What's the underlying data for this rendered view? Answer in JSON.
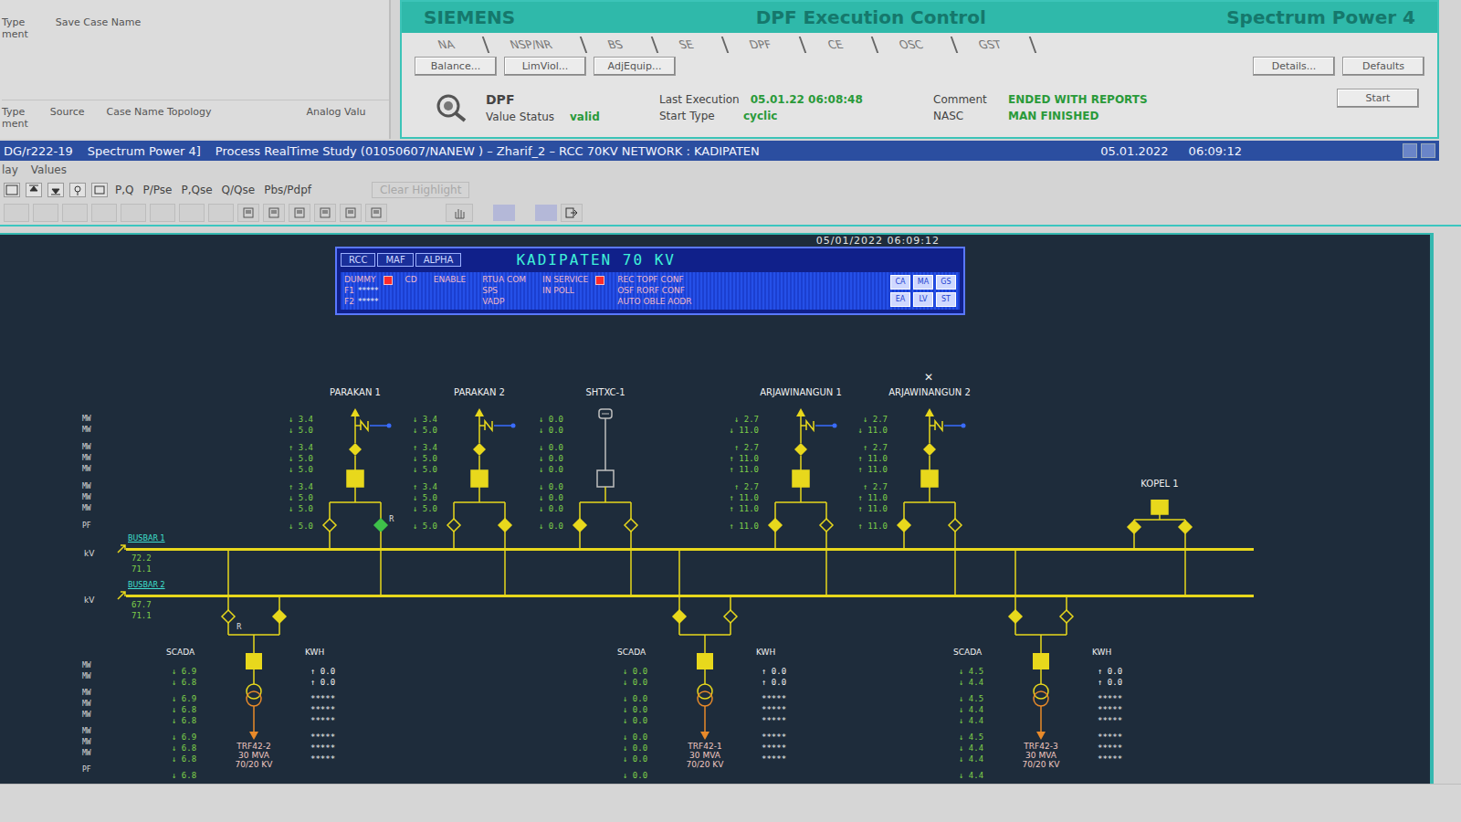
{
  "case_panel": {
    "top": [
      {
        "text": "Type",
        "sub": "ment"
      },
      {
        "text": "Save Case Name",
        "sub": ""
      }
    ],
    "bottom": [
      {
        "text": "Type",
        "sub": "ment"
      },
      {
        "text": "Source",
        "sub": ""
      },
      {
        "text": "Case Name Topology",
        "sub": ""
      },
      {
        "text": "Analog Valu",
        "sub": ""
      }
    ]
  },
  "dpf_panel": {
    "brand": "SIEMENS",
    "title": "DPF Execution Control",
    "product": "Spectrum Power 4",
    "tabs": [
      {
        "label": "NA",
        "selected": false
      },
      {
        "label": "NSP/NR",
        "selected": false
      },
      {
        "label": "BS",
        "selected": false
      },
      {
        "label": "SE",
        "selected": false
      },
      {
        "label": "DPF",
        "selected": false
      },
      {
        "label": "CE",
        "selected": false
      },
      {
        "label": "OSC",
        "selected": false
      },
      {
        "label": "GST",
        "selected": false
      }
    ],
    "buttons_left": [
      "Balance...",
      "LimViol...",
      "AdjEquip..."
    ],
    "buttons_right": [
      "Details...",
      "Defaults"
    ],
    "field_columns": [
      [
        {
          "label": "DPF",
          "value": ""
        },
        {
          "label": "Value Status",
          "value": "valid"
        }
      ],
      [
        {
          "label": "Last Execution",
          "value": "05.01.22 06:08:48"
        },
        {
          "label": "Start Type",
          "value": "cyclic"
        }
      ],
      [
        {
          "label": "Comment",
          "value": "ENDED WITH REPORTS"
        },
        {
          "label": "NASC",
          "value": "MAN FINISHED"
        }
      ]
    ],
    "start_button": "Start"
  },
  "title_bar": {
    "parts": [
      "DG/r222-19",
      "Spectrum Power 4]",
      "Process RealTime Study (01050607/NANEW ) – Zharif_2 – RCC 70KV NETWORK : KADIPATEN"
    ],
    "date": "05.01.2022",
    "time": "06:09:12"
  },
  "menu": [
    "lay",
    "Values"
  ],
  "toolbar": {
    "modes": [
      "P,Q",
      "P/Pse",
      "P,Qse",
      "Q/Qse",
      "Pbs/Pdpf"
    ],
    "clear": {
      "label": "Clear Highlight",
      "disabled": true
    }
  },
  "diagram": {
    "nav": [
      "RCC",
      "MAF",
      "ALPHA"
    ],
    "title": "KADIPATEN 70 KV",
    "timestamp": "05/01/2022 06:09:12",
    "status_groups": [
      {
        "items": [
          {
            "text": "DUMMY",
            "value": "",
            "alarm": true
          },
          {
            "text": "F1",
            "value": "*****",
            "alarm": false
          },
          {
            "text": "F2",
            "value": "*****",
            "alarm": false
          }
        ]
      },
      {
        "items": [
          {
            "text": "CD",
            "value": "",
            "alarm": false
          }
        ]
      },
      {
        "items": [
          {
            "text": "ENABLE",
            "value": "",
            "alarm": false
          }
        ]
      },
      {
        "items": [
          {
            "text": "RTUA COM",
            "value": "",
            "alarm": false
          },
          {
            "text": "SPS",
            "value": "",
            "alarm": false
          },
          {
            "text": "VADP",
            "value": "",
            "alarm": false
          }
        ]
      },
      {
        "items": [
          {
            "text": "IN SERVICE",
            "value": "",
            "alarm": true
          },
          {
            "text": "IN POLL",
            "value": "",
            "alarm": false
          }
        ]
      },
      {
        "items": [
          {
            "text": "REC TOPF CONF",
            "value": "",
            "alarm": false
          },
          {
            "text": "OSF RORF CONF",
            "value": "",
            "alarm": false
          },
          {
            "text": "AUTO OBLE AODR",
            "value": "",
            "alarm": false
          }
        ]
      }
    ],
    "flags": [
      "CA",
      "MA",
      "GS",
      "EA",
      "LV",
      "ST"
    ],
    "axis_top": [
      [
        "MW",
        "MW"
      ],
      [
        "MW",
        "MW",
        "MW"
      ],
      [
        "MW",
        "MW",
        "MW"
      ],
      [
        "PF"
      ]
    ],
    "axis_bus": [
      "kV",
      "kV"
    ],
    "axis_bottom": [
      [
        "MW",
        "MW"
      ],
      [
        "MW",
        "MW",
        "MW"
      ],
      [
        "MW",
        "MW",
        "MW"
      ],
      [
        "PF"
      ]
    ],
    "busbars": [
      {
        "name": "BUSBAR 1",
        "values": [
          "72.2",
          "71.1"
        ]
      },
      {
        "name": "BUSBAR 2",
        "values": [
          "67.7",
          "71.1"
        ]
      }
    ],
    "bays": [
      {
        "name": "PARAKAN 1",
        "kind": "feeder",
        "energized": true,
        "breaker_closed": true,
        "mark": "",
        "values": [
          [
            "↓ 3.4",
            "↓ 5.0"
          ],
          [
            "↑ 3.4",
            "↓ 5.0",
            "↓ 5.0"
          ],
          [
            "↑ 3.4",
            "↓ 5.0",
            "↓ 5.0"
          ],
          [
            "↓ 5.0"
          ]
        ],
        "switches": [
          {
            "closed": false,
            "tag": "",
            "color": "#e8d81c"
          },
          {
            "closed": true,
            "tag": "R",
            "color": "#3ec04a"
          }
        ]
      },
      {
        "name": "PARAKAN 2",
        "kind": "feeder",
        "energized": true,
        "breaker_closed": true,
        "mark": "",
        "values": [
          [
            "↓ 3.4",
            "↓ 5.0"
          ],
          [
            "↑ 3.4",
            "↓ 5.0",
            "↓ 5.0"
          ],
          [
            "↑ 3.4",
            "↓ 5.0",
            "↓ 5.0"
          ],
          [
            "↓ 5.0"
          ]
        ],
        "switches": [
          {
            "closed": false,
            "tag": "",
            "color": "#e8d81c"
          },
          {
            "closed": true,
            "tag": "",
            "color": "#e8d81c"
          }
        ]
      },
      {
        "name": "SHTXC-1",
        "kind": "capacitor",
        "energized": false,
        "breaker_closed": false,
        "mark": "",
        "values": [
          [
            "↓ 0.0",
            "↓ 0.0"
          ],
          [
            "↓ 0.0",
            "↓ 0.0",
            "↓ 0.0"
          ],
          [
            "↓ 0.0",
            "↓ 0.0",
            "↓ 0.0"
          ],
          [
            "↓ 0.0"
          ]
        ],
        "switches": [
          {
            "closed": true,
            "tag": "",
            "color": "#e8d81c"
          },
          {
            "closed": false,
            "tag": "",
            "color": "#e8d81c"
          }
        ]
      },
      {
        "name": "ARJAWINANGUN 1",
        "kind": "feeder",
        "energized": true,
        "breaker_closed": true,
        "mark": "",
        "values": [
          [
            "↓ 2.7",
            "↓ 11.0"
          ],
          [
            "↑ 2.7",
            "↑ 11.0",
            "↑ 11.0"
          ],
          [
            "↑ 2.7",
            "↑ 11.0",
            "↑ 11.0"
          ],
          [
            "↑ 11.0"
          ]
        ],
        "switches": [
          {
            "closed": true,
            "tag": "",
            "color": "#e8d81c"
          },
          {
            "closed": false,
            "tag": "",
            "color": "#e8d81c"
          }
        ]
      },
      {
        "name": "ARJAWINANGUN 2",
        "kind": "feeder",
        "energized": true,
        "breaker_closed": true,
        "mark": "✕",
        "values": [
          [
            "↓ 2.7",
            "↓ 11.0"
          ],
          [
            "↑ 2.7",
            "↑ 11.0",
            "↑ 11.0"
          ],
          [
            "↑ 2.7",
            "↑ 11.0",
            "↑ 11.0"
          ],
          [
            "↑ 11.0"
          ]
        ],
        "switches": [
          {
            "closed": true,
            "tag": "",
            "color": "#e8d81c"
          },
          {
            "closed": false,
            "tag": "",
            "color": "#e8d81c"
          }
        ]
      },
      {
        "name": "KOPEL 1",
        "kind": "coupler",
        "energized": true,
        "breaker_closed": true,
        "mark": "",
        "values": [],
        "switches": [
          {
            "closed": true,
            "tag": "",
            "color": "#e8d81c"
          },
          {
            "closed": true,
            "tag": "",
            "color": "#e8d81c"
          }
        ]
      }
    ],
    "transformers": [
      {
        "name": [
          "TRF42-2",
          "30 MVA",
          "70/20 KV"
        ],
        "scada": "SCADA",
        "meter": "KWH",
        "values": [
          [
            "↓ 6.9",
            "↓ 6.8"
          ],
          [
            "↓ 6.9",
            "↓ 6.8",
            "↓ 6.8"
          ],
          [
            "↓ 6.9",
            "↓ 6.8",
            "↓ 6.8"
          ],
          [
            "↓ 6.8"
          ]
        ],
        "meter_values": [
          [
            "↑ 0.0",
            "↑ 0.0"
          ],
          [
            "*****",
            "*****",
            "*****"
          ],
          [
            "*****",
            "*****",
            "*****"
          ]
        ],
        "switches": [
          {
            "closed": false,
            "tag": "R",
            "color": "#e8d81c"
          },
          {
            "closed": true,
            "tag": "",
            "color": "#e8d81c"
          }
        ]
      },
      {
        "name": [
          "TRF42-1",
          "30 MVA",
          "70/20 KV"
        ],
        "scada": "SCADA",
        "meter": "KWH",
        "values": [
          [
            "↓ 0.0",
            "↓ 0.0"
          ],
          [
            "↓ 0.0",
            "↓ 0.0",
            "↓ 0.0"
          ],
          [
            "↓ 0.0",
            "↓ 0.0",
            "↓ 0.0"
          ],
          [
            "↓ 0.0"
          ]
        ],
        "meter_values": [
          [
            "↑ 0.0",
            "↑ 0.0"
          ],
          [
            "*****",
            "*****",
            "*****"
          ],
          [
            "*****",
            "*****",
            "*****"
          ]
        ],
        "switches": [
          {
            "closed": true,
            "tag": "",
            "color": "#e8d81c"
          },
          {
            "closed": false,
            "tag": "",
            "color": "#e8d81c"
          }
        ]
      },
      {
        "name": [
          "TRF42-3",
          "30 MVA",
          "70/20 KV"
        ],
        "scada": "SCADA",
        "meter": "KWH",
        "values": [
          [
            "↓ 4.5",
            "↓ 4.4"
          ],
          [
            "↓ 4.5",
            "↓ 4.4",
            "↓ 4.4"
          ],
          [
            "↓ 4.5",
            "↓ 4.4",
            "↓ 4.4"
          ],
          [
            "↓ 4.4"
          ]
        ],
        "meter_values": [
          [
            "↑ 0.0",
            "↑ 0.0"
          ],
          [
            "*****",
            "*****",
            "*****"
          ],
          [
            "*****",
            "*****",
            "*****"
          ]
        ],
        "switches": [
          {
            "closed": true,
            "tag": "",
            "color": "#e8d81c"
          },
          {
            "closed": false,
            "tag": "",
            "color": "#e8d81c"
          }
        ]
      }
    ]
  }
}
